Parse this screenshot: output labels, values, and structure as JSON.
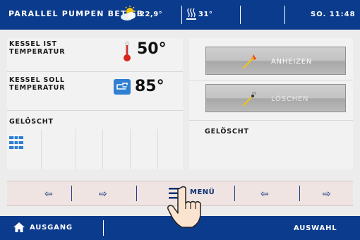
{
  "header": {
    "title": "PARALLEL PUMPEN BETIEB",
    "outdoor_temp": "22,9°",
    "indoor_temp": "31°",
    "clock": "SO. 11:48",
    "weather_icon": "sun-cloud-icon",
    "heat_icon": "radiator-icon"
  },
  "left_panel": {
    "kessel_ist_label_line1": "KESSEL IST",
    "kessel_ist_label_line2": "TEMPERATUR",
    "kessel_ist_value": "50°",
    "kessel_soll_label_line1": "KESSEL SOLL",
    "kessel_soll_label_line2": "TEMPERATUR",
    "kessel_soll_value": "85°",
    "status": "GELÖSCHT",
    "icons": [
      "thermometer-icon",
      "hand-pointer-icon",
      "mixer-icon"
    ]
  },
  "right_panel": {
    "anheizen_label": "ANHEIZEN",
    "loeschen_label": "LÖSCHEN",
    "status": "GELÖSCHT"
  },
  "navbar": {
    "menu_label": "MENÜ",
    "arrows": [
      "arrow-left-icon",
      "arrow-right-icon",
      "arrow-left-icon",
      "arrow-right-icon"
    ]
  },
  "footer": {
    "home_label": "AUSGANG",
    "select_label": "AUSWAHL"
  },
  "colors": {
    "bar_blue": "#0b3b8c",
    "panel_bg": "#f2f2f2",
    "nav_bg": "#efe4e2",
    "thermometer_red": "#d7261c",
    "icon_blue": "#2f7fd2"
  }
}
